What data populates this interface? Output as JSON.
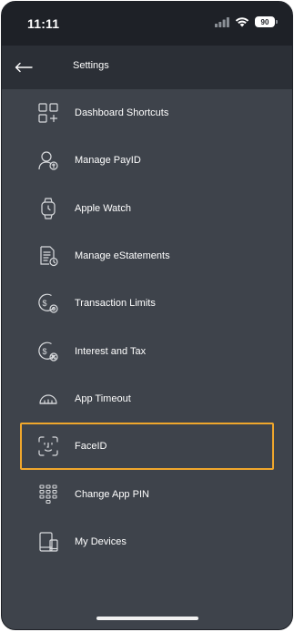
{
  "status_bar": {
    "time": "11:11",
    "battery": "90"
  },
  "header": {
    "title": "Settings"
  },
  "menu": [
    {
      "label": "Dashboard Shortcuts",
      "icon": "dashboard-shortcuts-icon"
    },
    {
      "label": "Manage PayID",
      "icon": "payid-icon"
    },
    {
      "label": "Apple Watch",
      "icon": "watch-icon"
    },
    {
      "label": "Manage eStatements",
      "icon": "estatements-icon"
    },
    {
      "label": "Transaction Limits",
      "icon": "transaction-limits-icon"
    },
    {
      "label": "Interest and Tax",
      "icon": "interest-tax-icon"
    },
    {
      "label": "App Timeout",
      "icon": "timeout-icon"
    },
    {
      "label": "FaceID",
      "icon": "faceid-icon",
      "selected": true
    },
    {
      "label": "Change App PIN",
      "icon": "keypad-icon"
    },
    {
      "label": "My Devices",
      "icon": "devices-icon"
    }
  ],
  "colors": {
    "background": "#3e434b",
    "header": "#2b2f36",
    "statusbar": "#1e2127",
    "highlight": "#f0a72c"
  }
}
